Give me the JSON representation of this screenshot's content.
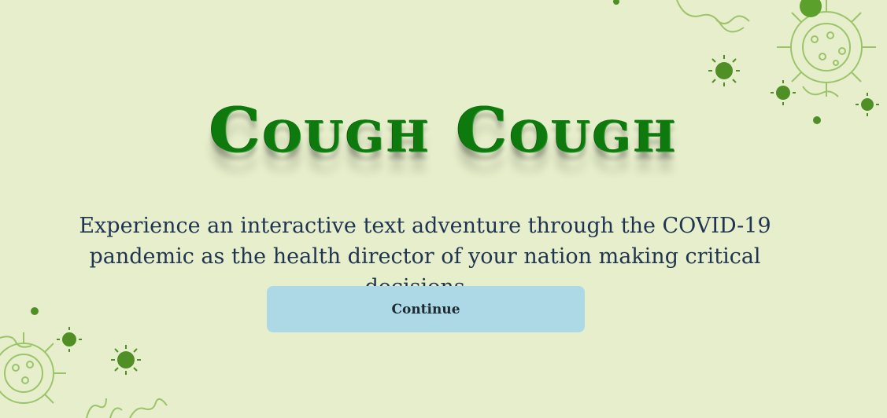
{
  "title": "Cough Cough",
  "description": "Experience an interactive text adventure through the COVID-19 pandemic as the health director of your nation making critical decisions...",
  "continue_button": {
    "label": "Continue"
  },
  "colors": {
    "background": "#e6eecb",
    "title": "#0e7a0e",
    "description": "#1f3450",
    "button": "#add8e6",
    "virus": "#5a9a2a"
  },
  "decorations": [
    "virus-icon"
  ]
}
